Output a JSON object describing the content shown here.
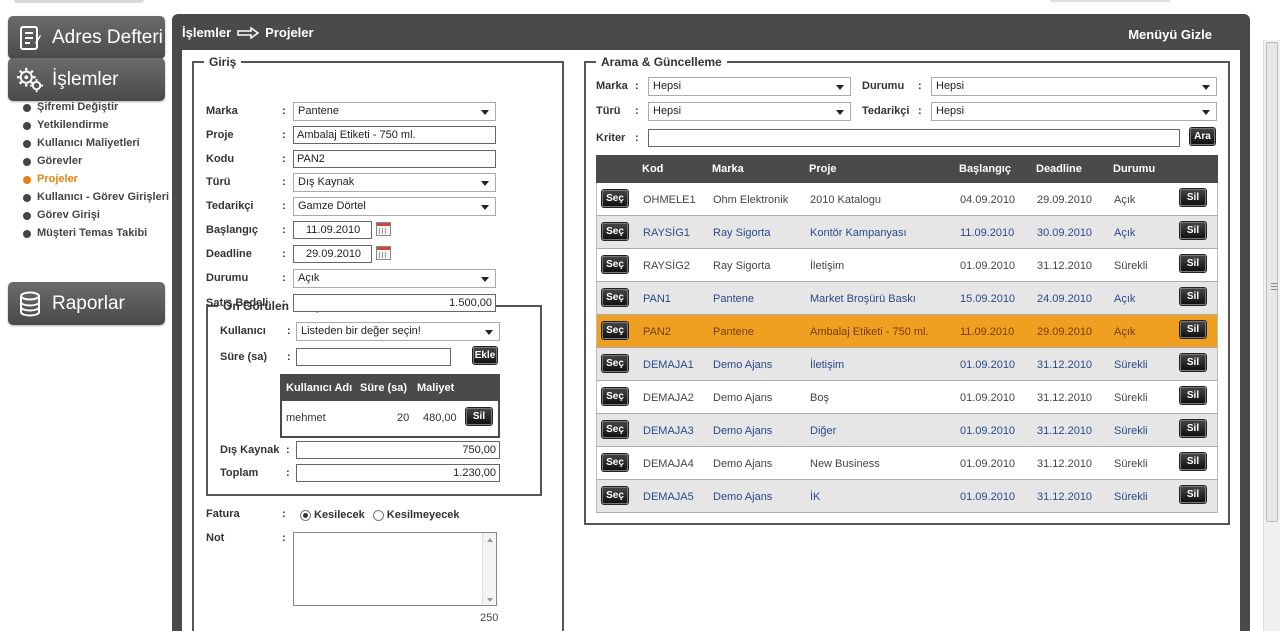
{
  "sidebar": {
    "address_book": "Adres Defteri",
    "operations": "İşlemler",
    "reports": "Raporlar",
    "items": [
      {
        "label": "Şifremi Değiştir",
        "active": false
      },
      {
        "label": "Yetkilendirme",
        "active": false
      },
      {
        "label": "Kullanıcı Maliyetleri",
        "active": false
      },
      {
        "label": "Görevler",
        "active": false
      },
      {
        "label": "Projeler",
        "active": true
      },
      {
        "label": "Kullanıcı - Görev Girişleri",
        "active": false
      },
      {
        "label": "Görev Girişi",
        "active": false
      },
      {
        "label": "Müşteri Temas Takibi",
        "active": false
      }
    ]
  },
  "header": {
    "crumb_1": "İşlemler",
    "crumb_2": "Projeler",
    "hide_menu": "Menüyü Gizle"
  },
  "entry": {
    "legend": "Giriş",
    "brand_label": "Marka",
    "brand_value": "Pantene",
    "project_label": "Proje",
    "project_value": "Ambalaj Etiketi - 750 ml.",
    "code_label": "Kodu",
    "code_value": "PAN2",
    "type_label": "Türü",
    "type_value": "Dış Kaynak",
    "supplier_label": "Tedarikçi",
    "supplier_value": "Gamze Dörtel",
    "start_label": "Başlangıç",
    "start_value": "11.09.2010",
    "deadline_label": "Deadline",
    "deadline_value": "29.09.2010",
    "status_label": "Durumu",
    "status_value": "Açık",
    "price_label": "Satış Bedeli",
    "price_value": "1.500,00",
    "colon": ":"
  },
  "cost": {
    "legend": "Ön Görülen Maliyet",
    "user_label": "Kullanıcı",
    "user_placeholder": "Listeden bir değer seçin!",
    "duration_label": "Süre (sa)",
    "duration_value": "",
    "add_button": "Ekle",
    "table_headers": [
      "Kullanıcı Adı",
      "Süre (sa)",
      "Maliyet"
    ],
    "rows": [
      {
        "user": "mehmet",
        "hours": "20",
        "cost": "480,00",
        "action": "Sil"
      }
    ],
    "external_label": "Dış Kaynak",
    "external_value": "750,00",
    "total_label": "Toplam",
    "total_value": "1.230,00"
  },
  "invoice": {
    "label": "Fatura",
    "option_yes": "Kesilecek",
    "option_no": "Kesilmeyecek",
    "selected": "Kesilecek"
  },
  "note": {
    "label": "Not",
    "value": "",
    "remaining": "250"
  },
  "search": {
    "legend": "Arama & Güncelleme",
    "brand_label": "Marka",
    "brand_value": "Hepsi",
    "status_label": "Durumu",
    "status_value": "Hepsi",
    "type_label": "Türü",
    "type_value": "Hepsi",
    "supplier_label": "Tedarikçi",
    "supplier_value": "Hepsi",
    "criteria_label": "Kriter",
    "criteria_value": "",
    "search_button": "Ara"
  },
  "results": {
    "headers": [
      "Kod",
      "Marka",
      "Proje",
      "Başlangıç",
      "Deadline",
      "Durumu"
    ],
    "select_label": "Seç",
    "delete_label": "Sil",
    "selected_code": "PAN2",
    "rows": [
      {
        "code": "OHMELE1",
        "brand": "Ohm Elektronik",
        "project": "2010 Katalogu",
        "start": "04.09.2010",
        "deadline": "29.09.2010",
        "status": "Açık"
      },
      {
        "code": "RAYSİG1",
        "brand": "Ray Sigorta",
        "project": "Kontör Kampanyası",
        "start": "11.09.2010",
        "deadline": "30.09.2010",
        "status": "Açık"
      },
      {
        "code": "RAYSİG2",
        "brand": "Ray Sigorta",
        "project": "İletişim",
        "start": "01.09.2010",
        "deadline": "31.12.2010",
        "status": "Sürekli"
      },
      {
        "code": "PAN1",
        "brand": "Pantene",
        "project": "Market Broşürü Baskı",
        "start": "15.09.2010",
        "deadline": "24.09.2010",
        "status": "Açık"
      },
      {
        "code": "PAN2",
        "brand": "Pantene",
        "project": "Ambalaj Etiketi - 750 ml.",
        "start": "11.09.2010",
        "deadline": "29.09.2010",
        "status": "Açık"
      },
      {
        "code": "DEMAJA1",
        "brand": "Demo Ajans",
        "project": "İletişim",
        "start": "01.09.2010",
        "deadline": "31.12.2010",
        "status": "Sürekli"
      },
      {
        "code": "DEMAJA2",
        "brand": "Demo Ajans",
        "project": "Boş",
        "start": "01.09.2010",
        "deadline": "31.12.2010",
        "status": "Sürekli"
      },
      {
        "code": "DEMAJA3",
        "brand": "Demo Ajans",
        "project": "Diğer",
        "start": "01.09.2010",
        "deadline": "31.12.2010",
        "status": "Sürekli"
      },
      {
        "code": "DEMAJA4",
        "brand": "Demo Ajans",
        "project": "New Business",
        "start": "01.09.2010",
        "deadline": "31.12.2010",
        "status": "Sürekli"
      },
      {
        "code": "DEMAJA5",
        "brand": "Demo Ajans",
        "project": "İK",
        "start": "01.09.2010",
        "deadline": "31.12.2010",
        "status": "Sürekli"
      }
    ]
  },
  "colors": {
    "accent_orange": "#f0a020",
    "active_nav": "#e8820e",
    "panel_dark": "#4a4a4a",
    "link_blue": "#2a4a8a"
  }
}
